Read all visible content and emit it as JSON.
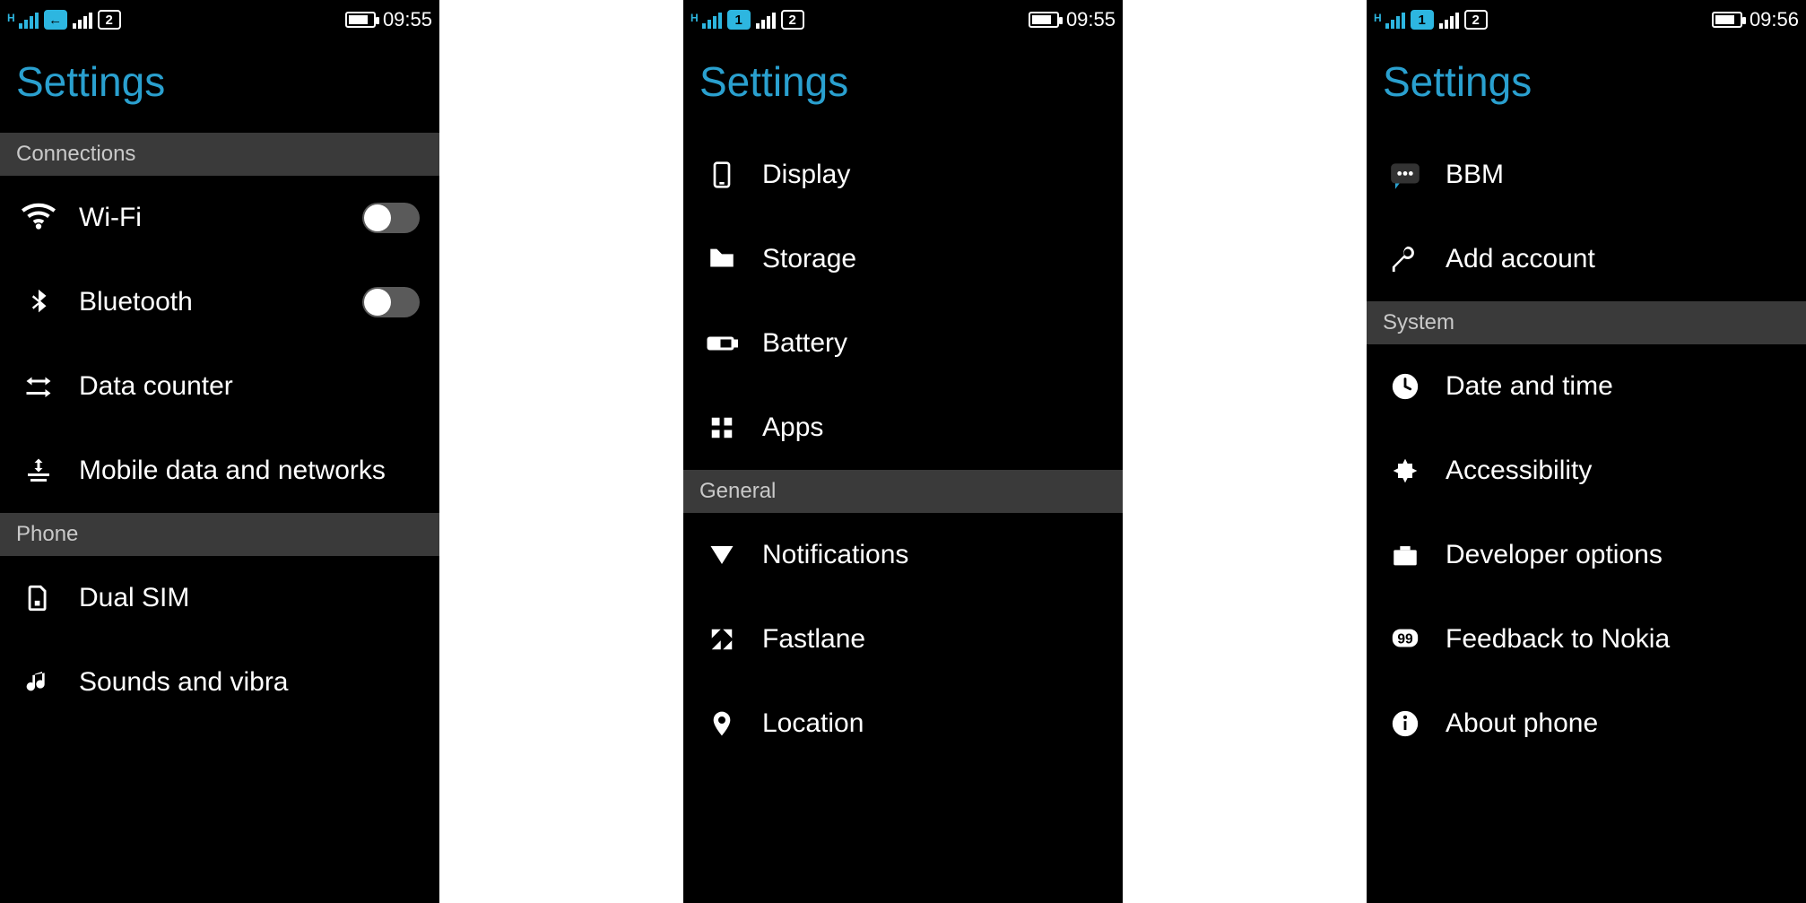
{
  "screens": [
    {
      "statusbar": {
        "h_indicator": "H",
        "sim1_badge": "←",
        "sim1_style": "arrow",
        "sim2_badge": "2",
        "sim2_style": "outline",
        "time": "09:55"
      },
      "title": "Settings",
      "sections": [
        {
          "header": "Connections",
          "items": [
            {
              "icon": "wifi-icon",
              "label": "Wi-Fi",
              "toggle": false
            },
            {
              "icon": "bluetooth-icon",
              "label": "Bluetooth",
              "toggle": false
            },
            {
              "icon": "data-counter-icon",
              "label": "Data counter"
            },
            {
              "icon": "mobile-data-icon",
              "label": "Mobile data and networks"
            }
          ]
        },
        {
          "header": "Phone",
          "items": [
            {
              "icon": "dual-sim-icon",
              "label": "Dual SIM"
            },
            {
              "icon": "sounds-icon",
              "label": "Sounds and vibra"
            }
          ]
        }
      ]
    },
    {
      "statusbar": {
        "h_indicator": "H",
        "sim1_badge": "1",
        "sim1_style": "cyan",
        "sim2_badge": "2",
        "sim2_style": "outline",
        "time": "09:55"
      },
      "title": "Settings",
      "sections": [
        {
          "header": null,
          "items": [
            {
              "icon": "display-icon",
              "label": "Display"
            },
            {
              "icon": "storage-icon",
              "label": "Storage"
            },
            {
              "icon": "battery-icon",
              "label": "Battery"
            },
            {
              "icon": "apps-icon",
              "label": "Apps"
            }
          ]
        },
        {
          "header": "General",
          "items": [
            {
              "icon": "notifications-icon",
              "label": "Notifications"
            },
            {
              "icon": "fastlane-icon",
              "label": "Fastlane"
            },
            {
              "icon": "location-icon",
              "label": "Location"
            }
          ]
        }
      ]
    },
    {
      "statusbar": {
        "h_indicator": "H",
        "sim1_badge": "1",
        "sim1_style": "cyan",
        "sim2_badge": "2",
        "sim2_style": "outline",
        "time": "09:56"
      },
      "title": "Settings",
      "sections": [
        {
          "header": null,
          "items": [
            {
              "icon": "bbm-icon",
              "label": "BBM"
            },
            {
              "icon": "add-account-icon",
              "label": "Add account"
            }
          ]
        },
        {
          "header": "System",
          "items": [
            {
              "icon": "clock-icon",
              "label": "Date and time"
            },
            {
              "icon": "accessibility-icon",
              "label": "Accessibility"
            },
            {
              "icon": "developer-icon",
              "label": "Developer options"
            },
            {
              "icon": "feedback-icon",
              "label": "Feedback to Nokia"
            },
            {
              "icon": "about-icon",
              "label": "About phone"
            }
          ]
        }
      ]
    }
  ]
}
